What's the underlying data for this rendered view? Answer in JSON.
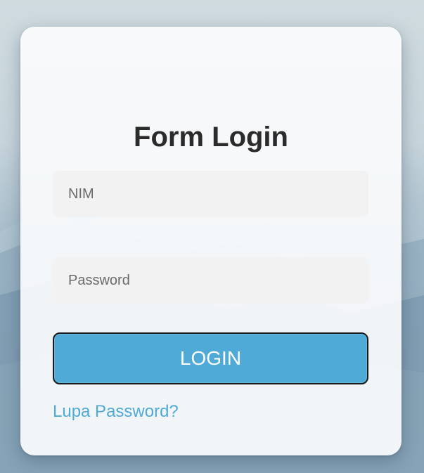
{
  "form": {
    "title": "Form Login",
    "nim_placeholder": "NIM",
    "password_placeholder": "Password",
    "login_label": "LOGIN",
    "forgot_password_label": "Lupa Password?"
  },
  "colors": {
    "accent": "#4faad8",
    "card_background": "#fafbfc",
    "field_background": "#f2f2f2",
    "title_text": "#2b2b2b",
    "button_border": "#1a1a1a"
  }
}
